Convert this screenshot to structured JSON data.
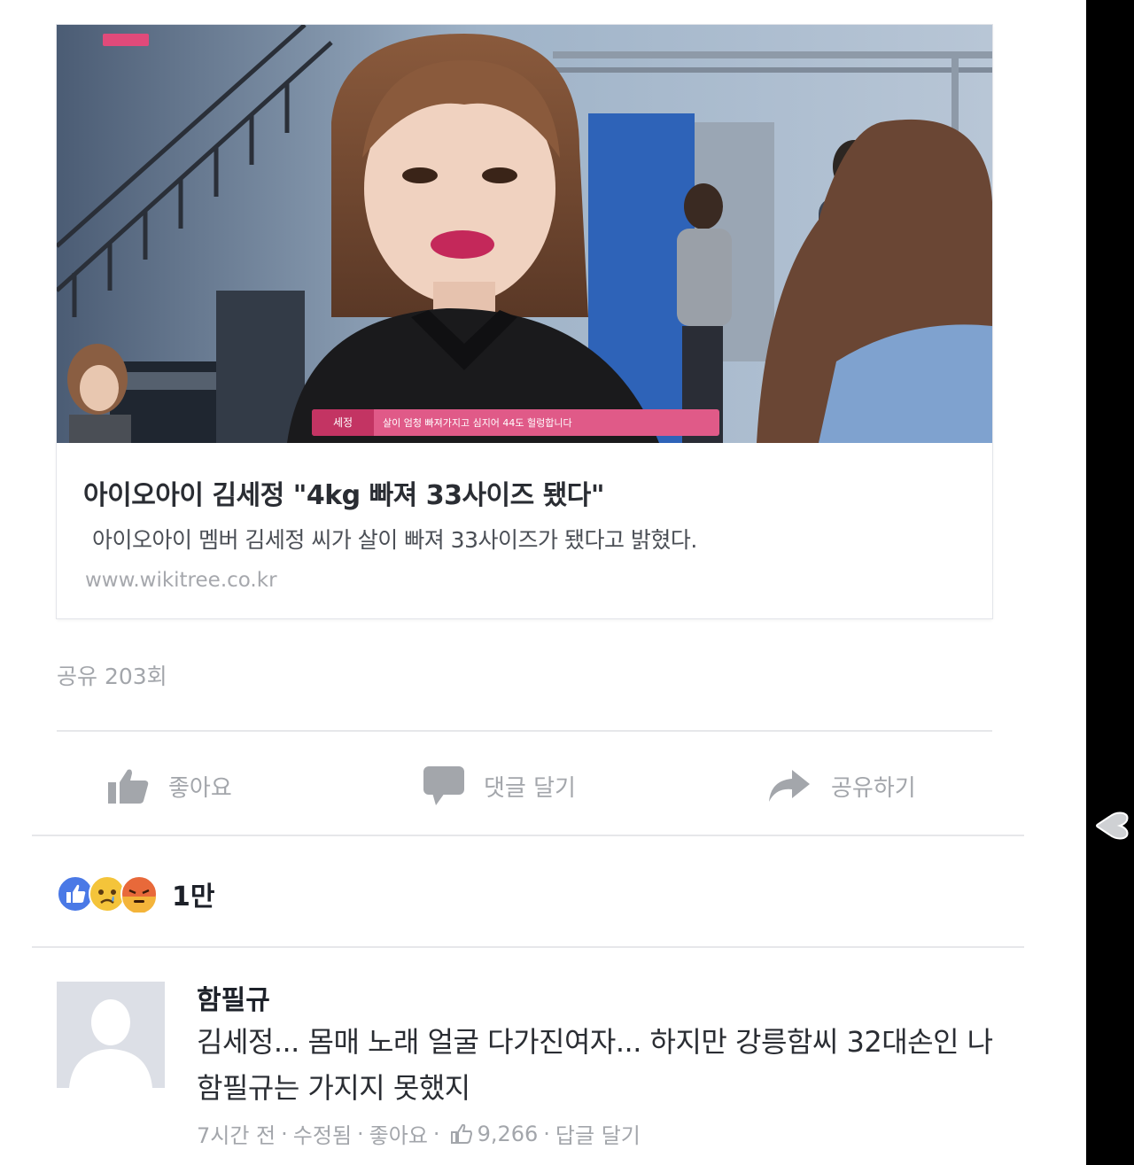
{
  "post": {
    "link_card": {
      "image_badge": "",
      "image_caption_tag": "세정",
      "image_caption_text": "살이 엄청 빠져가지고 심지어 44도 헐렁합니다",
      "title": "아이오아이 김세정 \"4kg 빠져 33사이즈 됐다\"",
      "description": "아이오아이 멤버 김세정 씨가 살이 빠져 33사이즈가 됐다고 밝혔다.",
      "domain": "www.wikitree.co.kr"
    },
    "share_count": "공유 203회",
    "actions": {
      "like_label": "좋아요",
      "comment_label": "댓글 달기",
      "share_label": "공유하기"
    },
    "reactions": {
      "icons": [
        "like-reaction",
        "sad-reaction",
        "angry-reaction"
      ],
      "count": "1만"
    }
  },
  "comment": {
    "author": "함필규",
    "text": "김세정... 몸매 노래 얼굴 다가진여자... 하지만 강릉함씨 32대손인 나 함필규는 가지지 못했지",
    "meta": {
      "time": "7시간 전",
      "edited": "수정됨",
      "like": "좋아요",
      "like_count": "9,266",
      "reply": "답글 달기",
      "separator": "·"
    }
  },
  "colors": {
    "brand_blue": "#4a79e6",
    "text_dark": "#1d2129",
    "text_muted": "#a3a6ab",
    "caption_pink": "#e05a88"
  }
}
